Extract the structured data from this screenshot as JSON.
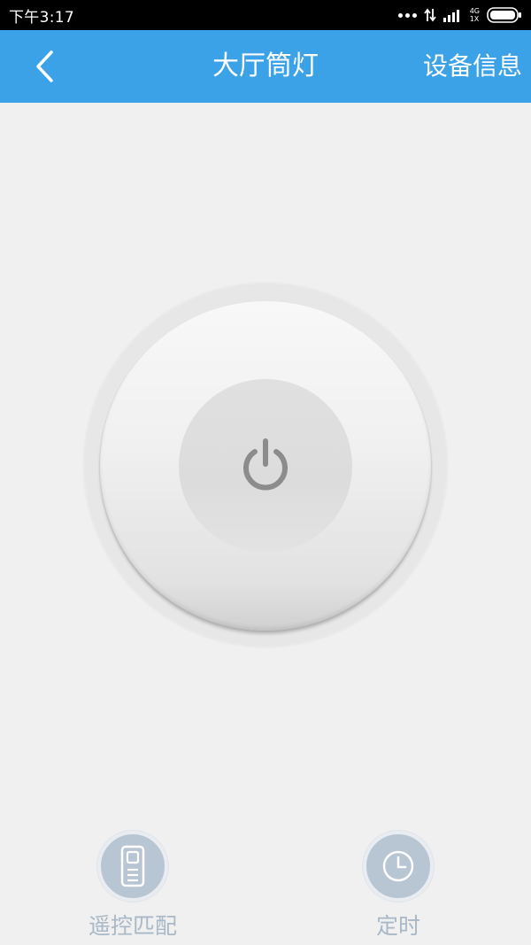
{
  "status_bar": {
    "time": "下午3:17",
    "network_top": "4G",
    "network_bottom": "1X"
  },
  "header": {
    "title": "大厅筒灯",
    "device_info_label": "设备信息"
  },
  "power_button": {
    "icon": "power-icon"
  },
  "actions": {
    "remote_match_label": "遥控匹配",
    "remote_icon": "remote-control-icon",
    "timer_label": "定时",
    "timer_icon": "clock-icon"
  },
  "colors": {
    "header_bg": "#3ba2e8",
    "page_bg": "#f0f0f0",
    "action_circle": "#b8c6d4",
    "action_label": "#a9b8c6",
    "power_icon": "#8c8c8c"
  }
}
